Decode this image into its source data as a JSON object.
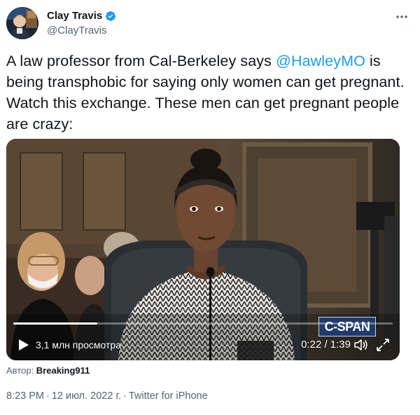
{
  "author": {
    "display_name": "Clay Travis",
    "handle": "@ClayTravis",
    "verified": true,
    "verified_color": "#1d9bf0"
  },
  "tweet": {
    "text_part1": "A law professor from Cal-Berkeley says ",
    "mention": "@HawleyMO",
    "text_part2": " is being transphobic for saying only women can get pregnant. Watch this exchange. These men can get pregnant people are crazy:"
  },
  "video": {
    "network_logo": "C-SPAN",
    "views": "3,1 млн просмотра",
    "time": "0:22 / 1:39",
    "progress_fraction": 0.222,
    "play_icon": "play-icon",
    "volume_icon": "volume-icon",
    "fullscreen_icon": "fullscreen-icon"
  },
  "attribution": {
    "prefix": "Автор: ",
    "source": "Breaking911"
  },
  "meta": {
    "time": "8:23 PM",
    "date": "12 июл. 2022 г.",
    "client": "Twitter for iPhone",
    "separator": "·"
  },
  "colors": {
    "text": "#0f1419",
    "secondary": "#536471",
    "link": "#1d9bf0"
  }
}
